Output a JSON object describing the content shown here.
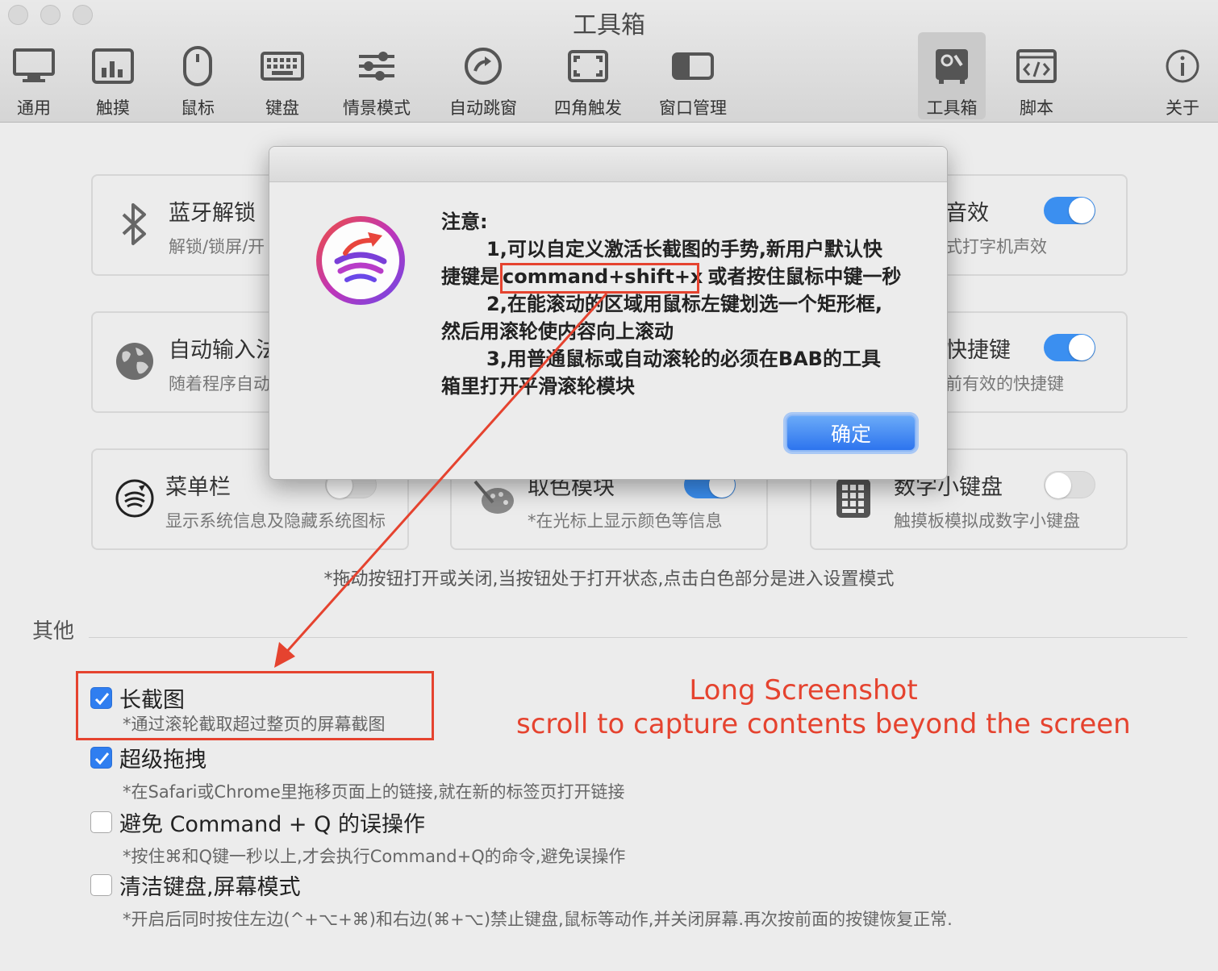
{
  "window": {
    "title": "工具箱"
  },
  "toolbar": {
    "items": [
      {
        "label": "通用",
        "icon": "monitor-icon"
      },
      {
        "label": "触摸",
        "icon": "trackpad-icon"
      },
      {
        "label": "鼠标",
        "icon": "mouse-icon"
      },
      {
        "label": "键盘",
        "icon": "keyboard-icon"
      },
      {
        "label": "情景模式",
        "icon": "sliders-icon"
      },
      {
        "label": "自动跳窗",
        "icon": "arrow-circle-icon"
      },
      {
        "label": "四角触发",
        "icon": "corners-icon"
      },
      {
        "label": "窗口管理",
        "icon": "window-icon"
      },
      {
        "label": "工具箱",
        "icon": "toolbox-icon",
        "active": true
      },
      {
        "label": "脚本",
        "icon": "code-icon"
      },
      {
        "label": "关于",
        "icon": "info-icon"
      }
    ]
  },
  "cards": [
    {
      "title": "蓝牙解锁",
      "subtitle": "解锁/锁屏/开",
      "icon": "bluetooth-icon"
    },
    {
      "title": "音效",
      "subtitle": "式打字机声效",
      "icon": "none",
      "toggle": "on"
    },
    {
      "title": "自动输入法",
      "subtitle": "随着程序自动",
      "icon": "globe-icon"
    },
    {
      "title": "快捷键",
      "subtitle": "前有效的快捷键",
      "icon": "none",
      "toggle": "on"
    },
    {
      "title": "菜单栏",
      "subtitle": "显示系统信息及隐藏系统图标",
      "icon": "menubar-logo-icon",
      "toggle": "off"
    },
    {
      "title": "取色模块",
      "subtitle": "*在光标上显示颜色等信息",
      "icon": "palette-icon",
      "toggle": "on"
    },
    {
      "title": "数字小键盘",
      "subtitle": "触摸板模拟成数字小键盘",
      "icon": "numpad-icon",
      "toggle": "off"
    }
  ],
  "hint": "*拖动按钮打开或关闭,当按钮处于打开状态,点击白色部分是进入设置模式",
  "others": {
    "title": "其他",
    "options": [
      {
        "title": "长截图",
        "subtitle": "*通过滚轮截取超过整页的屏幕截图",
        "checked": true
      },
      {
        "title": "超级拖拽",
        "subtitle": "*在Safari或Chrome里拖移页面上的链接,就在新的标签页打开链接",
        "checked": true
      },
      {
        "title": "避免 Command + Q 的误操作",
        "subtitle": "*按住⌘和Q键一秒以上,才会执行Command+Q的命令,避免误操作",
        "checked": false
      },
      {
        "title": "清洁键盘,屏幕模式",
        "subtitle": "*开启后同时按住左边(^+⌥+⌘)和右边(⌘+⌥)禁止键盘,鼠标等动作,并关闭屏幕.再次按前面的按键恢复正常.",
        "checked": false
      }
    ]
  },
  "dialog": {
    "heading": "注意:",
    "line1a": "1,可以自定义激活长截图的手势,新用户默认快",
    "line1b_pre": "捷键是",
    "shortcut": "command+shift+x",
    "line1b_post": "或者按住鼠标中键一秒",
    "line2a": "2,在能滚动的区域用鼠标左键划选一个矩形框,",
    "line2b": "然后用滚轮使内容向上滚动",
    "line3a": "3,用普通鼠标或自动滚轮的必须在BAB的工具",
    "line3b": "箱里打开平滑滚轮模块",
    "ok_label": "确定"
  },
  "annotation": {
    "line1": "Long Screenshot",
    "line2": "scroll to capture contents beyond the screen"
  },
  "colors": {
    "accent": "#3b8ff0",
    "annotation": "#e5432f",
    "background": "#ececec"
  }
}
